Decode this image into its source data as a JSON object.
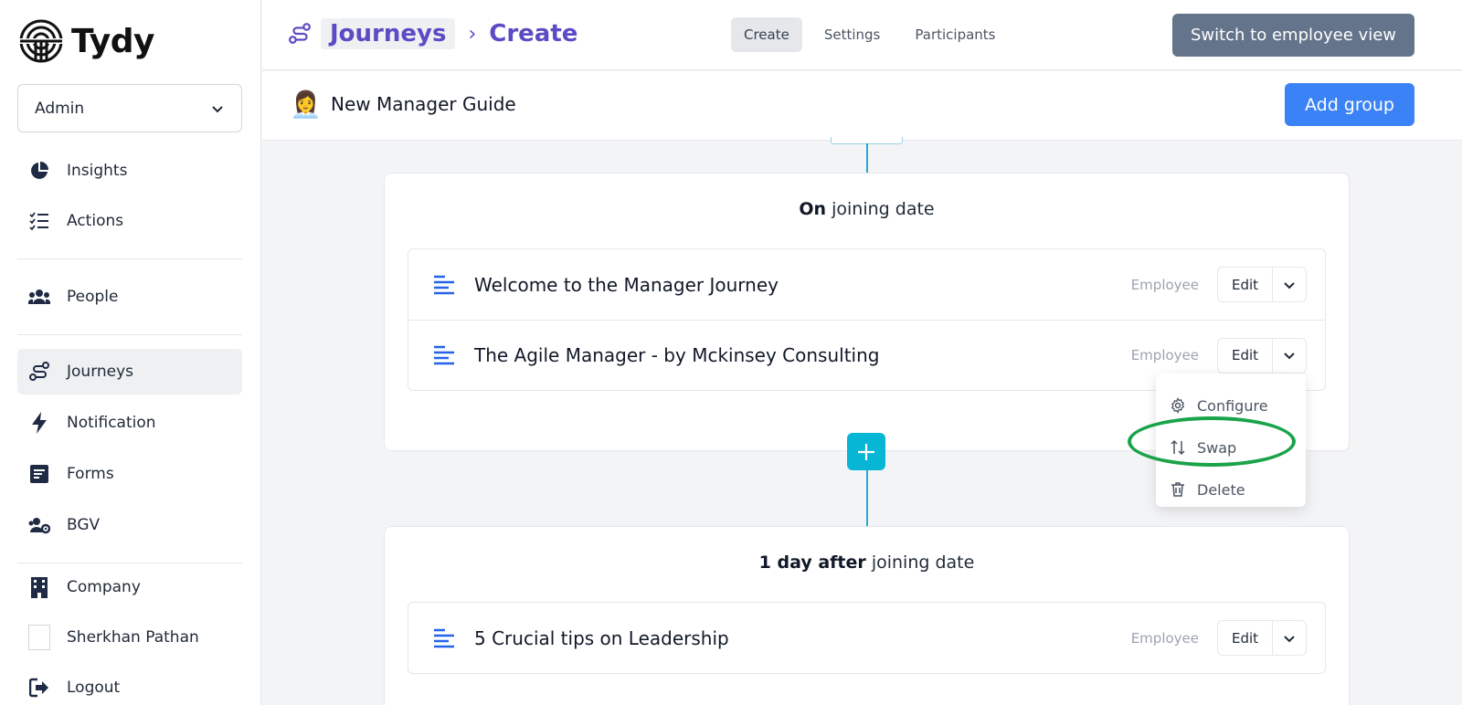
{
  "brand": {
    "name": "Tydy"
  },
  "role_select": {
    "value": "Admin"
  },
  "sidebar": {
    "items": [
      {
        "label": "Insights",
        "icon": "pie-chart-icon"
      },
      {
        "label": "Actions",
        "icon": "checklist-icon"
      },
      {
        "label": "People",
        "icon": "people-icon"
      },
      {
        "label": "Journeys",
        "icon": "journey-icon",
        "active": true
      },
      {
        "label": "Notification",
        "icon": "bolt-icon"
      },
      {
        "label": "Forms",
        "icon": "form-icon"
      },
      {
        "label": "BGV",
        "icon": "user-gear-icon"
      },
      {
        "label": "Company",
        "icon": "building-icon"
      },
      {
        "label": "Sherkhan Pathan",
        "icon": "avatar"
      },
      {
        "label": "Logout",
        "icon": "logout-icon"
      }
    ]
  },
  "breadcrumb": {
    "parent": "Journeys",
    "current": "Create"
  },
  "tabs": [
    {
      "label": "Create",
      "active": true
    },
    {
      "label": "Settings"
    },
    {
      "label": "Participants"
    }
  ],
  "switch_view_label": "Switch to employee view",
  "journey": {
    "title": "New Manager Guide",
    "emoji": "👩‍💼",
    "add_group_label": "Add group"
  },
  "groups": [
    {
      "heading_bold": "On",
      "heading_rest": "joining date",
      "items": [
        {
          "title": "Welcome to the Manager Journey",
          "role": "Employee",
          "edit": "Edit"
        },
        {
          "title": "The Agile Manager - by Mckinsey Consulting",
          "role": "Employee",
          "edit": "Edit"
        }
      ]
    },
    {
      "heading_bold": "1 day after",
      "heading_rest": "joining date",
      "items": [
        {
          "title": "5 Crucial tips on Leadership",
          "role": "Employee",
          "edit": "Edit"
        }
      ]
    }
  ],
  "dropdown": {
    "items": [
      {
        "label": "Configure",
        "icon": "gear-icon"
      },
      {
        "label": "Swap",
        "icon": "swap-icon"
      },
      {
        "label": "Delete",
        "icon": "trash-icon"
      }
    ]
  },
  "colors": {
    "accent_purple": "#5b4bc4",
    "primary_blue": "#3b82f6",
    "cyan": "#06b6d4",
    "highlight_green": "#1aa34a",
    "slate_button": "#64748b"
  }
}
